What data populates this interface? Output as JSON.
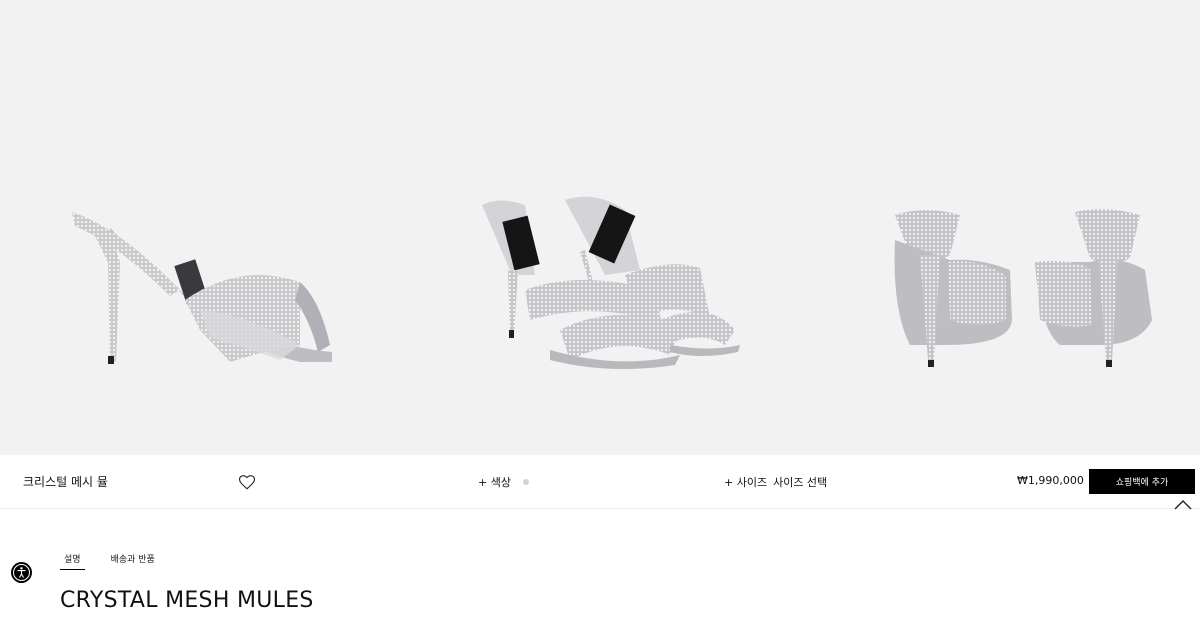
{
  "product": {
    "name": "크리스털 메시 뮬",
    "title": "CRYSTAL MESH MULES",
    "price": "₩1,990,000"
  },
  "options": {
    "color_label": "+ 색상",
    "size_label": "+ 사이즈",
    "size_value": "사이즈 선택"
  },
  "actions": {
    "add_to_bag": "쇼핑백에 추가"
  },
  "tabs": [
    {
      "label": "설명",
      "active": true
    },
    {
      "label": "배송과 반품",
      "active": false
    }
  ],
  "colors": {
    "gallery_bg": "#f2f2f2",
    "button_bg": "#000000",
    "swatch": "#d4d4d4"
  },
  "icons": [
    "heart-icon",
    "chevron-up-icon",
    "accessibility-icon"
  ]
}
